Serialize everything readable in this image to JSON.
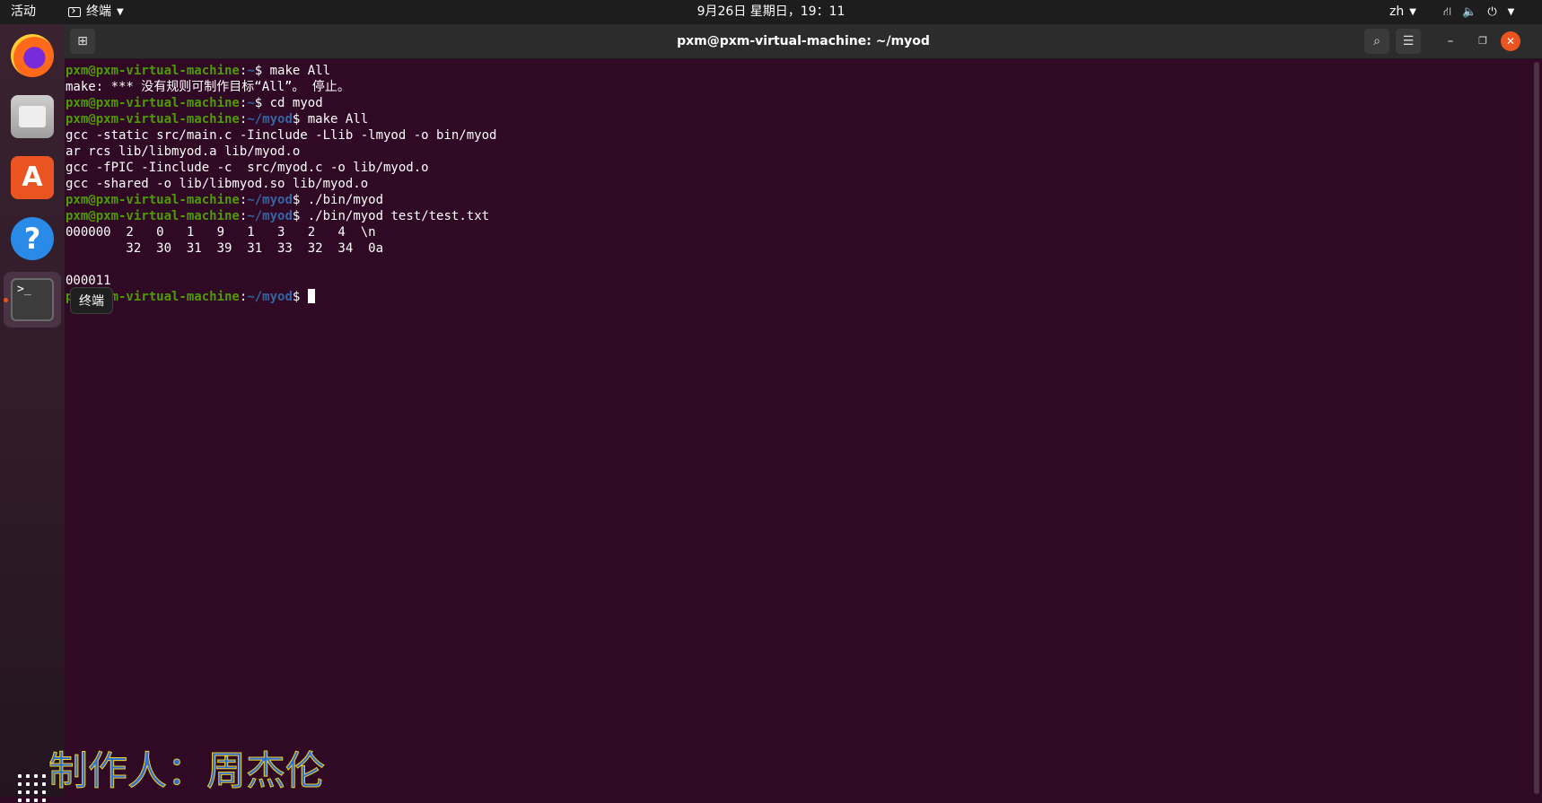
{
  "topbar": {
    "activities": "活动",
    "app_name": "终端",
    "clock": "9月26日 星期日，19：11",
    "language": "zh",
    "icons": [
      "network-icon",
      "volume-icon",
      "power-icon"
    ]
  },
  "dock": {
    "apps": [
      "firefox",
      "files",
      "software",
      "help",
      "terminal"
    ],
    "tooltip": "终端"
  },
  "window": {
    "title": "pxm@pxm-virtual-machine: ~/myod"
  },
  "terminal": {
    "lines": [
      {
        "user": "pxm@pxm-virtual-machine",
        "path": "~",
        "cmd": " make All"
      },
      {
        "text": "make: *** 没有规则可制作目标“All”。 停止。"
      },
      {
        "user": "pxm@pxm-virtual-machine",
        "path": "~",
        "cmd": " cd myod"
      },
      {
        "user": "pxm@pxm-virtual-machine",
        "path": "~/myod",
        "cmd": " make All"
      },
      {
        "text": "gcc -static src/main.c -Iinclude -Llib -lmyod -o bin/myod"
      },
      {
        "text": "ar rcs lib/libmyod.a lib/myod.o"
      },
      {
        "text": "gcc -fPIC -Iinclude -c  src/myod.c -o lib/myod.o"
      },
      {
        "text": "gcc -shared -o lib/libmyod.so lib/myod.o"
      },
      {
        "user": "pxm@pxm-virtual-machine",
        "path": "~/myod",
        "cmd": " ./bin/myod"
      },
      {
        "user": "pxm@pxm-virtual-machine",
        "path": "~/myod",
        "cmd": " ./bin/myod test/test.txt"
      },
      {
        "text": "000000  2   0   1   9   1   3   2   4  \\n"
      },
      {
        "text": "        32  30  31  39  31  33  32  34  0a"
      },
      {
        "text": ""
      },
      {
        "text": "000011"
      },
      {
        "user": "pxm@pxm-virtual-machine",
        "path": "~/myod",
        "cmd": " ",
        "cursor": true
      }
    ]
  },
  "watermark": "制作人：周杰伦",
  "colors": {
    "background": "#300a24",
    "user": "#4e9a06",
    "path": "#3465a4",
    "accent": "#e95420"
  }
}
